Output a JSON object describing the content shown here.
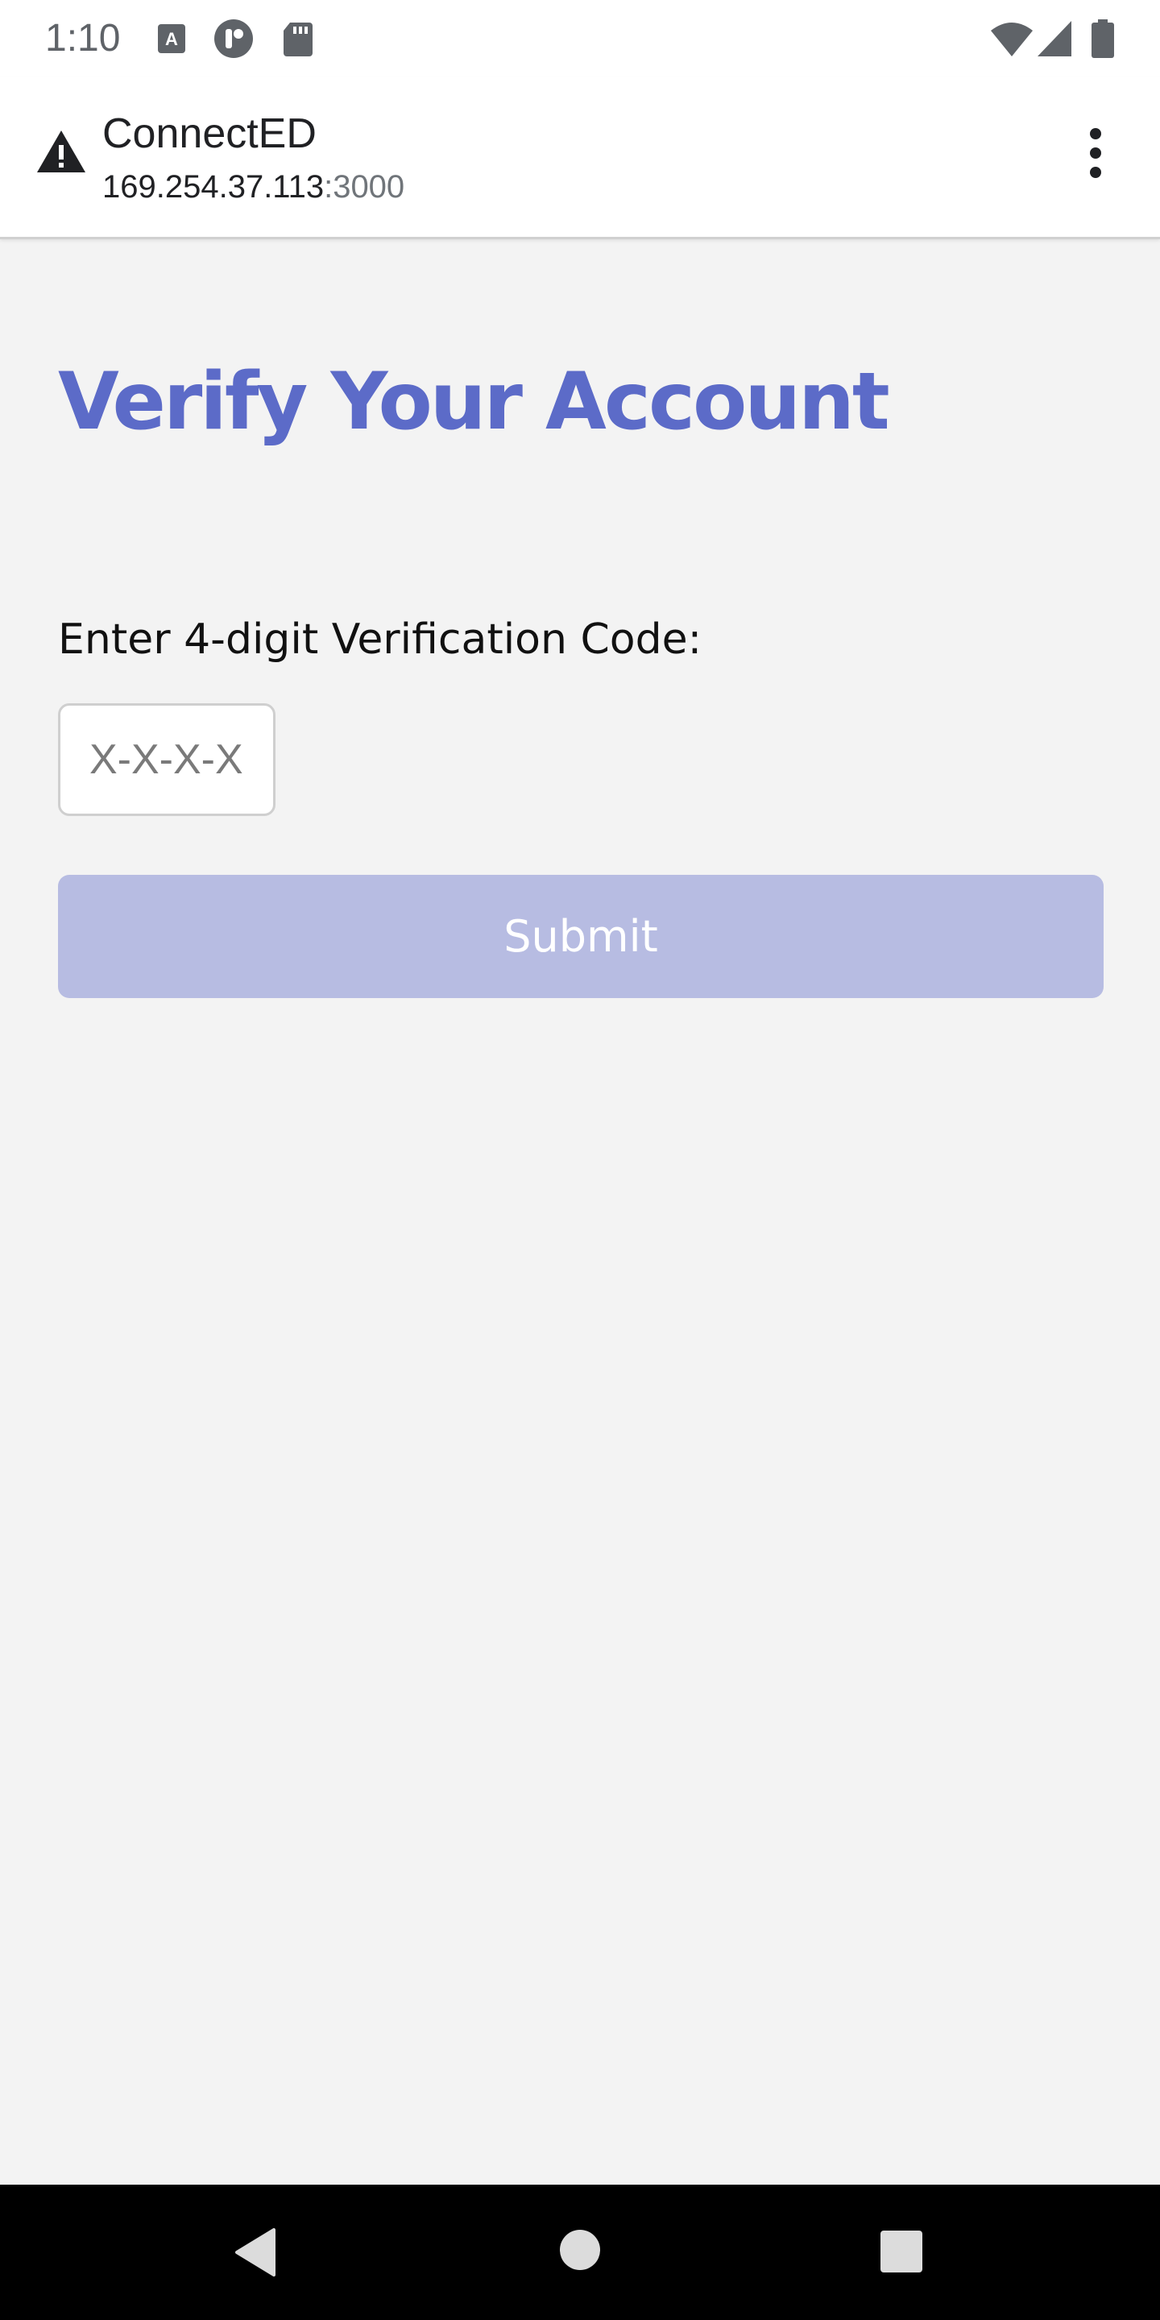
{
  "status_bar": {
    "time": "1:10",
    "left_icons": [
      "text-a-icon",
      "circle-app-icon",
      "sd-card-icon"
    ],
    "right_icons": [
      "wifi-icon",
      "signal-icon",
      "battery-icon"
    ]
  },
  "browser": {
    "site_title": "ConnectED",
    "url_host": "169.254.37.113",
    "url_port": ":3000",
    "security_icon": "warning-icon",
    "menu_icon": "more-vert-icon"
  },
  "page": {
    "heading": "Verify Your Account",
    "code_label": "Enter 4-digit Verification Code:",
    "code_placeholder": "X-X-X-X",
    "code_value": "",
    "submit_label": "Submit"
  },
  "nav_bar": {
    "icons": [
      "back-icon",
      "home-icon",
      "recents-icon"
    ]
  },
  "colors": {
    "accent": "#5c6bc8",
    "button_disabled": "#b7bce2",
    "background": "#f3f3f3"
  }
}
